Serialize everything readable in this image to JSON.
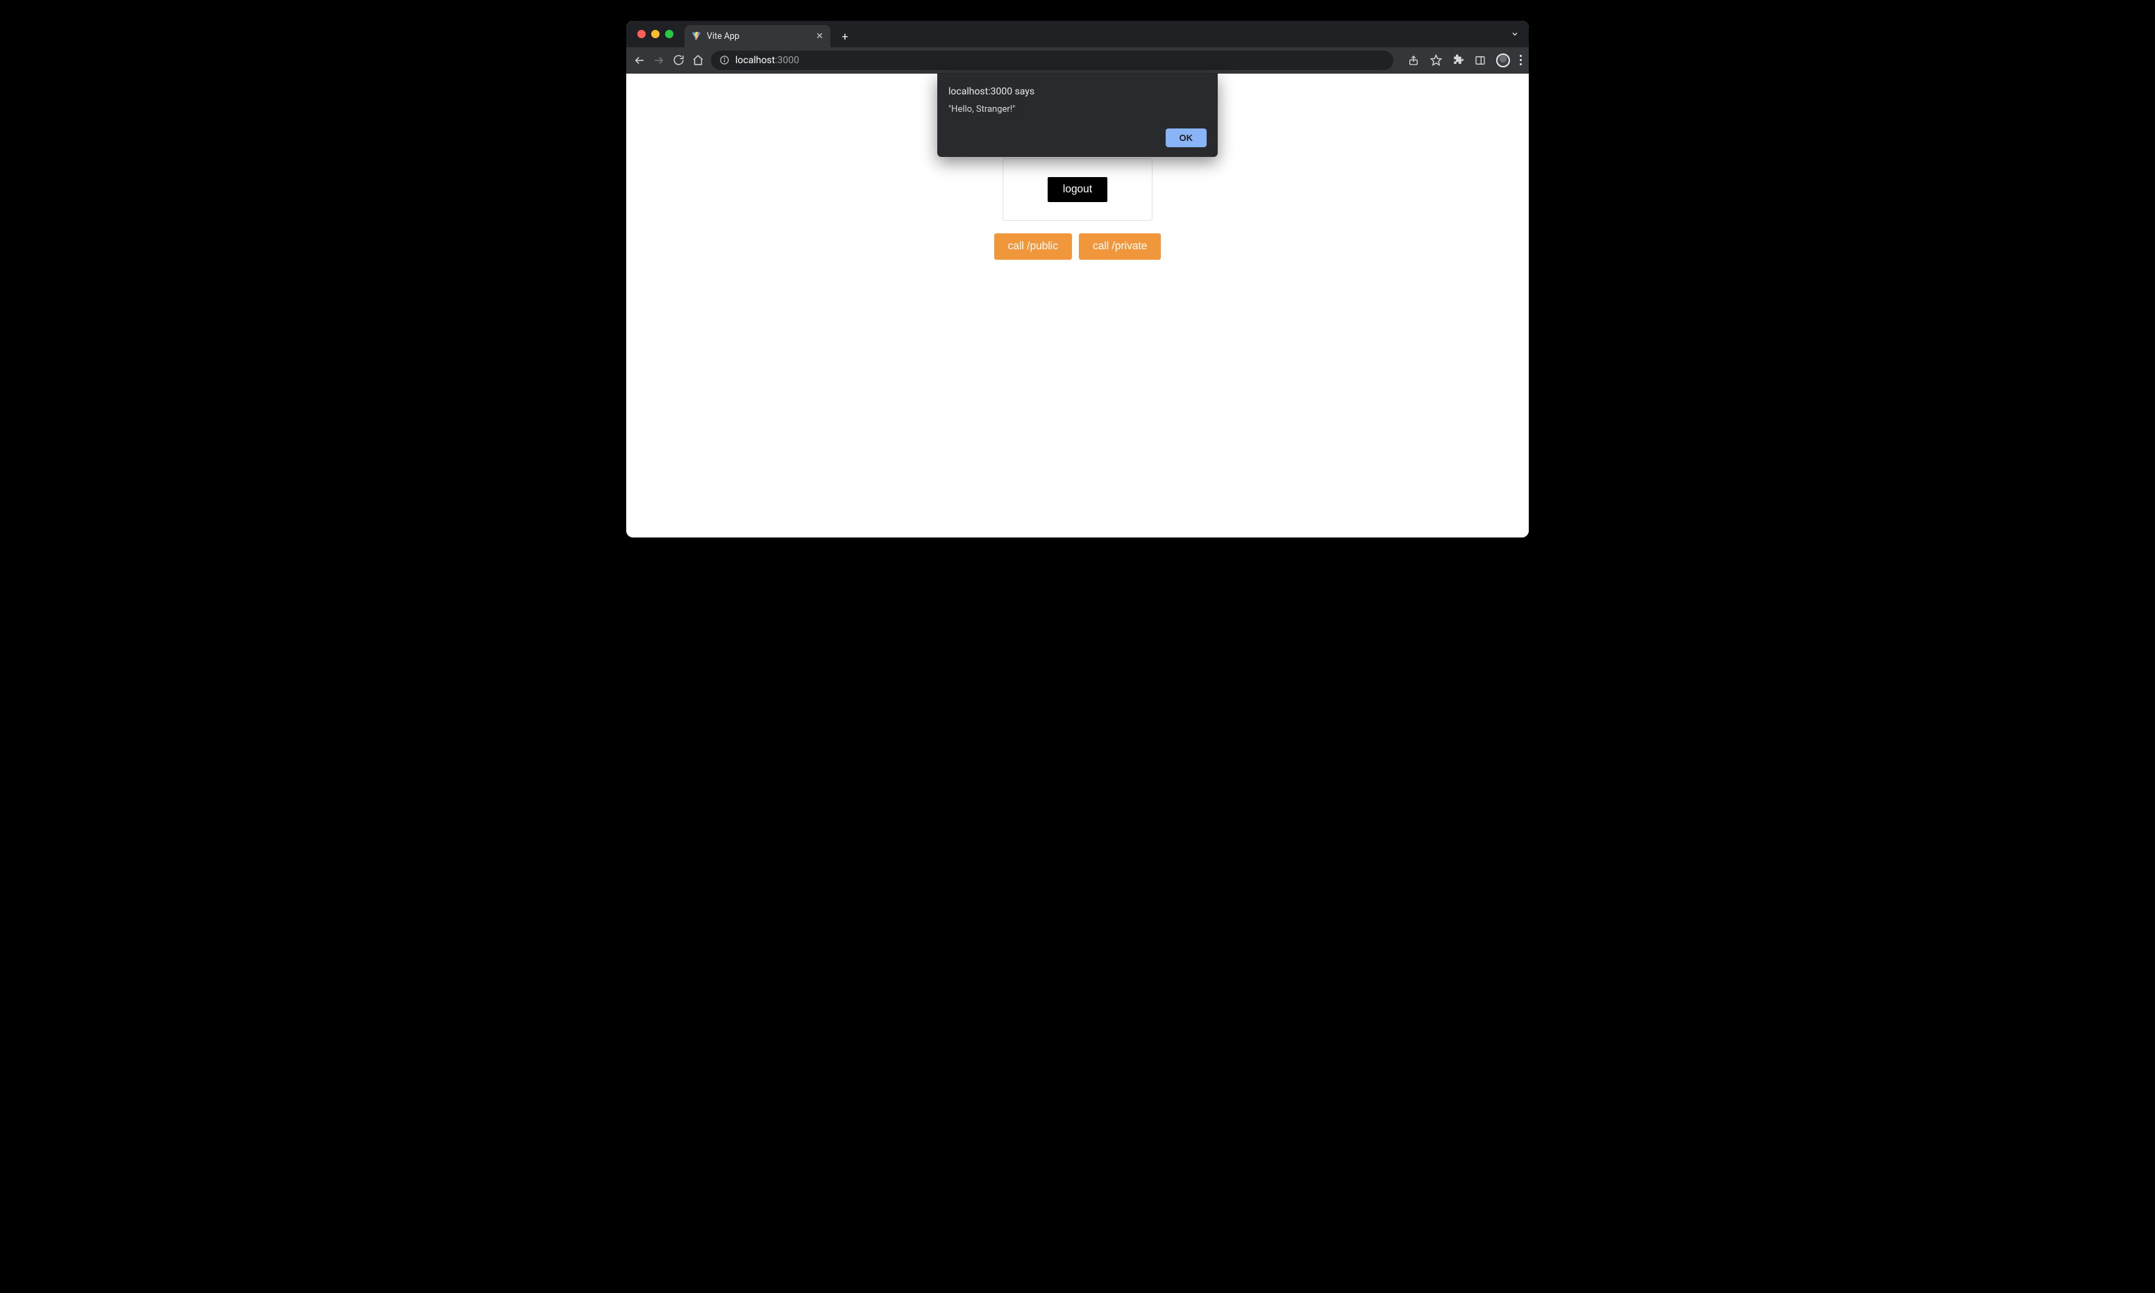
{
  "browser": {
    "tab_title": "Vite App",
    "url_host": "localhost",
    "url_port": ":3000"
  },
  "alert": {
    "origin_line": "localhost:3000 says",
    "message": "\"Hello, Stranger!\"",
    "ok_label": "OK"
  },
  "page": {
    "logout_label": "logout",
    "call_public_label": "call /public",
    "call_private_label": "call /private"
  }
}
